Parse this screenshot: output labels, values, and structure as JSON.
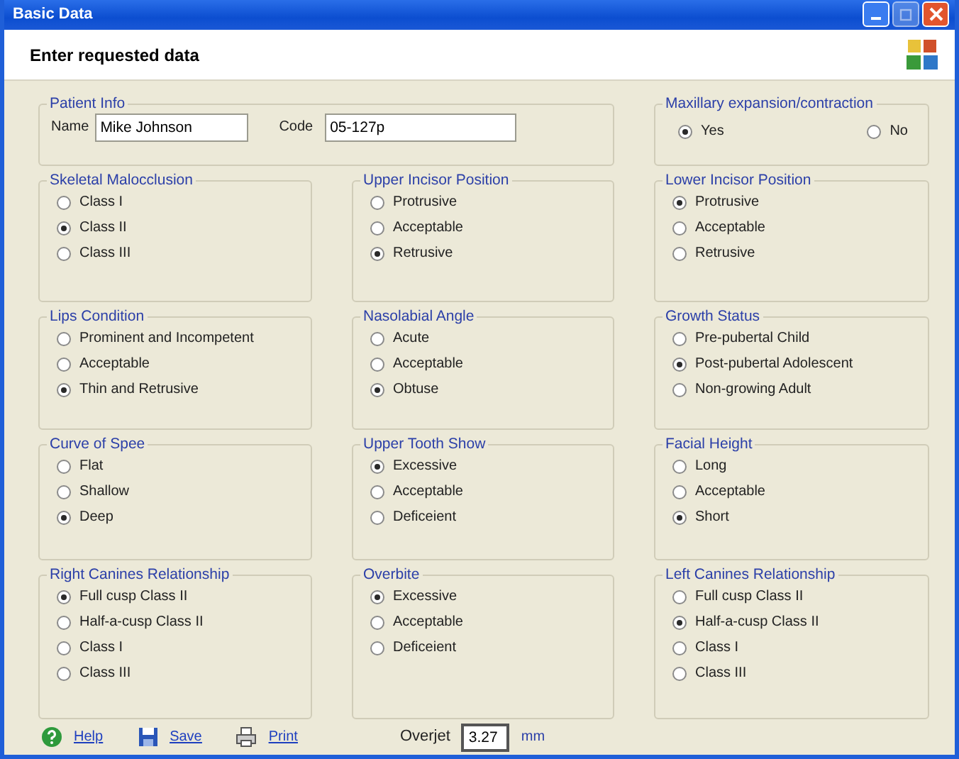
{
  "window": {
    "title": "Basic Data"
  },
  "header": {
    "title": "Enter requested data"
  },
  "rows": [
    {
      "panels": [
        {
          "kind": "fields",
          "title": "Patient Info",
          "fields": [
            {
              "label": "Name",
              "value": "Mike Johnson"
            },
            {
              "label": "Code",
              "value": "05-127p"
            }
          ]
        },
        {
          "kind": "radio-row",
          "title": "Maxillary expansion/contraction",
          "options": [
            {
              "label": "Yes",
              "selected": true
            },
            {
              "label": "No",
              "selected": false
            }
          ]
        }
      ]
    },
    {
      "panels": [
        {
          "kind": "radios",
          "title": "Skeletal Malocclusion",
          "options": [
            {
              "label": "Class I",
              "selected": false
            },
            {
              "label": "Class II",
              "selected": true
            },
            {
              "label": "Class III",
              "selected": false
            }
          ]
        },
        {
          "kind": "radios",
          "title": "Upper Incisor Position",
          "options": [
            {
              "label": "Protrusive",
              "selected": false
            },
            {
              "label": "Acceptable",
              "selected": false
            },
            {
              "label": "Retrusive",
              "selected": true
            }
          ]
        },
        {
          "kind": "radios",
          "title": "Lower Incisor Position",
          "options": [
            {
              "label": "Protrusive",
              "selected": true
            },
            {
              "label": "Acceptable",
              "selected": false
            },
            {
              "label": "Retrusive",
              "selected": false
            }
          ]
        }
      ]
    },
    {
      "panels": [
        {
          "kind": "radios",
          "title": "Lips Condition",
          "options": [
            {
              "label": "Prominent and Incompetent",
              "selected": false
            },
            {
              "label": "Acceptable",
              "selected": false
            },
            {
              "label": "Thin and Retrusive",
              "selected": true
            }
          ]
        },
        {
          "kind": "radios",
          "title": "Nasolabial Angle",
          "options": [
            {
              "label": "Acute",
              "selected": false
            },
            {
              "label": "Acceptable",
              "selected": false
            },
            {
              "label": "Obtuse",
              "selected": true
            }
          ]
        },
        {
          "kind": "radios",
          "title": "Growth Status",
          "options": [
            {
              "label": "Pre-pubertal Child",
              "selected": false
            },
            {
              "label": "Post-pubertal Adolescent",
              "selected": true
            },
            {
              "label": "Non-growing Adult",
              "selected": false
            }
          ]
        }
      ]
    },
    {
      "panels": [
        {
          "kind": "radios",
          "title": "Curve of Spee",
          "options": [
            {
              "label": "Flat",
              "selected": false
            },
            {
              "label": "Shallow",
              "selected": false
            },
            {
              "label": "Deep",
              "selected": true
            }
          ]
        },
        {
          "kind": "radios",
          "title": "Upper Tooth Show",
          "options": [
            {
              "label": "Excessive",
              "selected": true
            },
            {
              "label": "Acceptable",
              "selected": false
            },
            {
              "label": "Deficeient",
              "selected": false
            }
          ]
        },
        {
          "kind": "radios",
          "title": "Facial Height",
          "options": [
            {
              "label": "Long",
              "selected": false
            },
            {
              "label": "Acceptable",
              "selected": false
            },
            {
              "label": "Short",
              "selected": true
            }
          ]
        }
      ]
    },
    {
      "panels": [
        {
          "kind": "radios",
          "title": "Right Canines Relationship",
          "options": [
            {
              "label": "Full cusp Class II",
              "selected": true
            },
            {
              "label": "Half-a-cusp Class II",
              "selected": false
            },
            {
              "label": "Class I",
              "selected": false
            },
            {
              "label": "Class III",
              "selected": false
            }
          ]
        },
        {
          "kind": "radios",
          "title": "Overbite",
          "options": [
            {
              "label": "Excessive",
              "selected": true
            },
            {
              "label": "Acceptable",
              "selected": false
            },
            {
              "label": "Deficeient",
              "selected": false
            }
          ]
        },
        {
          "kind": "radios",
          "title": "Left Canines Relationship",
          "options": [
            {
              "label": "Full cusp Class II",
              "selected": false
            },
            {
              "label": "Half-a-cusp Class II",
              "selected": true
            },
            {
              "label": "Class I",
              "selected": false
            },
            {
              "label": "Class III",
              "selected": false
            }
          ]
        }
      ]
    }
  ],
  "footer": {
    "links": [
      {
        "kind": "help",
        "label": "Help"
      },
      {
        "kind": "save",
        "label": "Save"
      },
      {
        "kind": "print",
        "label": "Print"
      }
    ],
    "overjet": {
      "label": "Overjet",
      "value": "3.27",
      "unit": "mm"
    }
  }
}
